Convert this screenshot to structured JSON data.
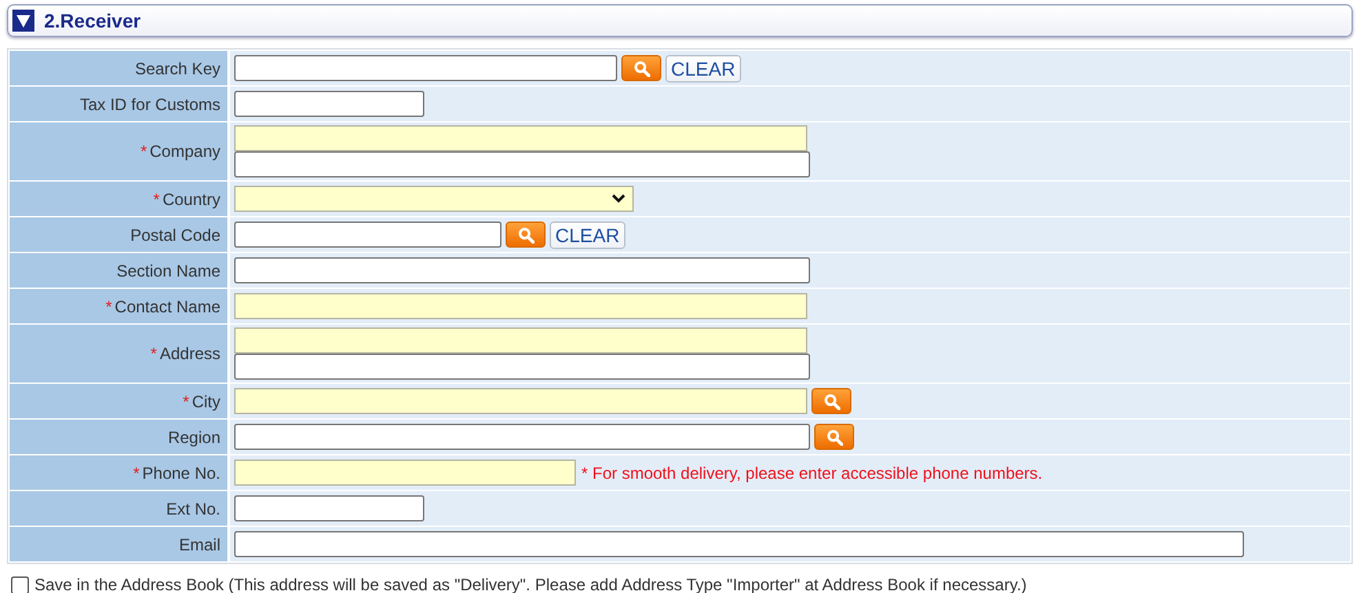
{
  "section": {
    "title": "2.Receiver",
    "expanded": true
  },
  "rows": [
    {
      "label": "Search Key",
      "controls": [
        {
          "kind": "input-medium",
          "required": false
        },
        {
          "kind": "search"
        },
        {
          "kind": "clear",
          "text": "CLEAR"
        }
      ]
    },
    {
      "label": "Tax ID for Customs",
      "controls": [
        {
          "kind": "input-short",
          "required": false
        }
      ]
    },
    {
      "label": "Company",
      "marker": "*",
      "controls": [
        {
          "kind": "input-long",
          "required": true
        },
        {
          "kind": "input-long",
          "required": false
        }
      ]
    },
    {
      "label": "Country",
      "marker": "*",
      "controls": [
        {
          "kind": "select",
          "required": true
        }
      ]
    },
    {
      "label": "Postal Code",
      "controls": [
        {
          "kind": "input-postal",
          "required": false
        },
        {
          "kind": "search"
        },
        {
          "kind": "clear",
          "text": "CLEAR"
        }
      ]
    },
    {
      "label": "Section Name",
      "controls": [
        {
          "kind": "input-long",
          "required": false
        }
      ]
    },
    {
      "label": "Contact Name",
      "marker": "*",
      "controls": [
        {
          "kind": "input-long",
          "required": true
        }
      ]
    },
    {
      "label": "Address",
      "marker": "*",
      "controls": [
        {
          "kind": "input-long",
          "required": true
        },
        {
          "kind": "input-long",
          "required": false
        }
      ]
    },
    {
      "label": "City",
      "marker": "*",
      "controls": [
        {
          "kind": "input-long",
          "required": true
        },
        {
          "kind": "search"
        }
      ]
    },
    {
      "label": "Region",
      "controls": [
        {
          "kind": "input-long",
          "required": false
        },
        {
          "kind": "search"
        }
      ]
    },
    {
      "label": "Phone No.",
      "marker": "*",
      "controls": [
        {
          "kind": "input-phone",
          "required": true
        },
        {
          "kind": "note",
          "text": "* For smooth delivery, please enter accessible phone numbers."
        }
      ]
    },
    {
      "label": "Ext No.",
      "controls": [
        {
          "kind": "input-short",
          "required": false
        }
      ]
    },
    {
      "label": "Email",
      "controls": [
        {
          "kind": "input-wide",
          "required": false
        }
      ]
    }
  ],
  "save_option": {
    "label": "Save in the Address Book (This address will be saved as \"Delivery\". Please add Address Type \"Importer\" at Address Book if necessary.)",
    "checked": false
  }
}
